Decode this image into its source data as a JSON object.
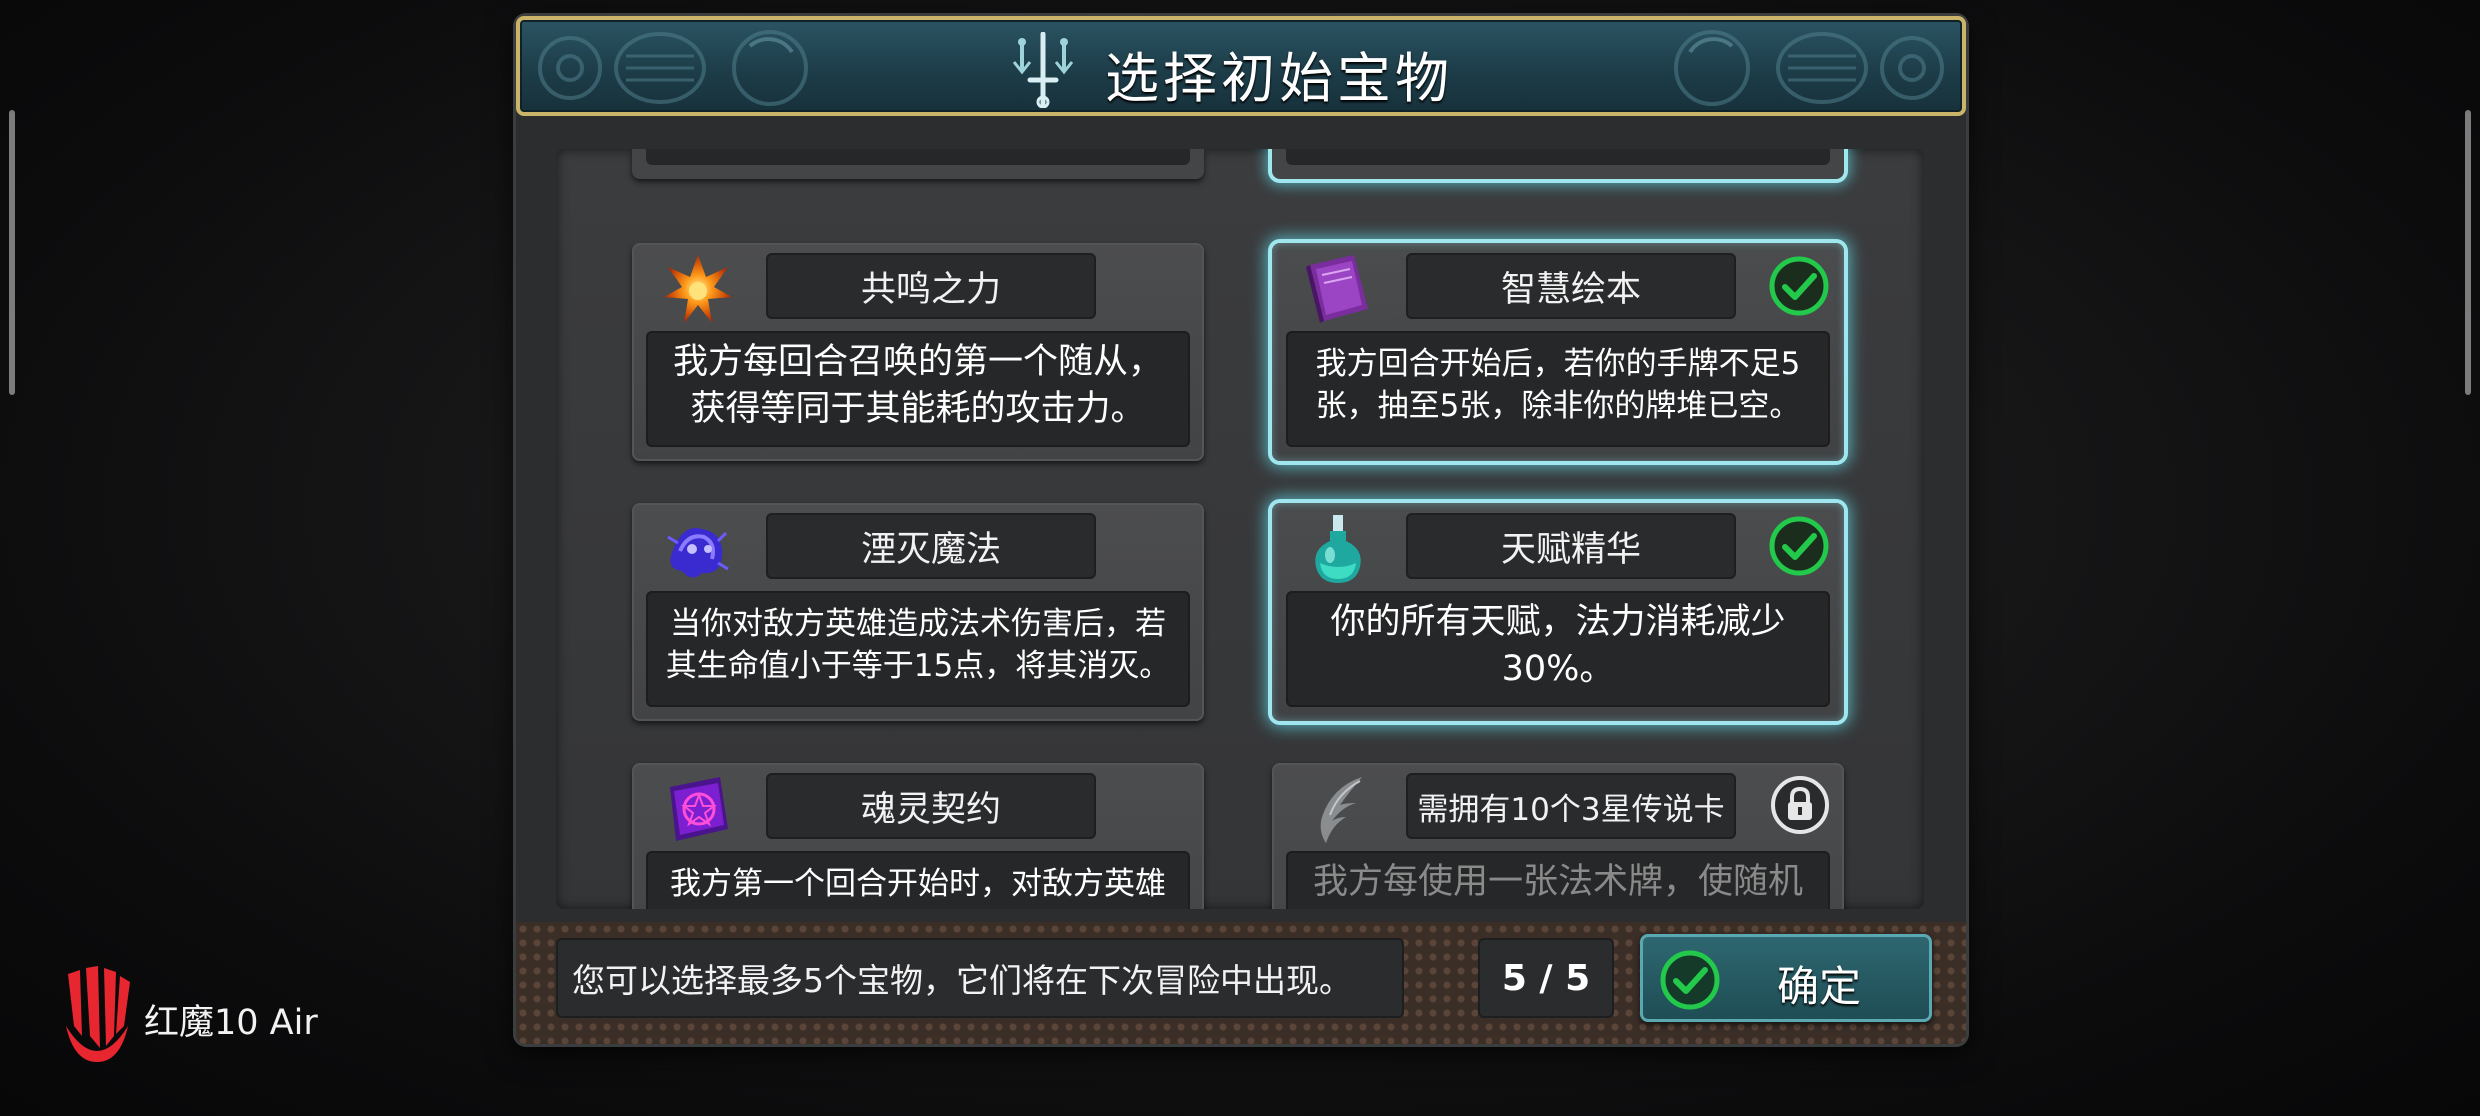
{
  "device_watermark": {
    "text": "红魔10 Air"
  },
  "dialog": {
    "title": "选择初始宝物",
    "title_icon": "sword-rune-icon"
  },
  "treasures": [
    {
      "name": "共鸣之力",
      "description": "我方每回合召唤的第一个随从，获得等同于其能耗的攻击力。",
      "icon": "orange-burst-icon",
      "selected": false,
      "locked": false
    },
    {
      "name": "智慧绘本",
      "description": "我方回合开始后，若你的手牌不足5张，抽至5张，除非你的牌堆已空。",
      "icon": "purple-book-icon",
      "selected": true,
      "locked": false
    },
    {
      "name": "湮灭魔法",
      "description": "当你对敌方英雄造成法术伤害后，若其生命值小于等于15点，将其消灭。",
      "icon": "blue-spirit-icon",
      "selected": false,
      "locked": false
    },
    {
      "name": "天赋精华",
      "description": "你的所有天赋，法力消耗减少30%。",
      "icon": "teal-potion-icon",
      "selected": true,
      "locked": false
    },
    {
      "name": "魂灵契约",
      "description": "我方第一个回合开始时，对敌方英雄造",
      "icon": "purple-scroll-icon",
      "selected": false,
      "locked": false
    },
    {
      "name": "需拥有10个3星传说卡",
      "description": "我方每使用一张法术牌，使随机",
      "icon": "silver-wing-icon",
      "selected": false,
      "locked": true
    }
  ],
  "footer": {
    "hint": "您可以选择最多5个宝物，它们将在下次冒险中出现。",
    "count": "5 / 5",
    "selected_count": 5,
    "max_count": 5,
    "confirm_label": "确定"
  },
  "colors": {
    "title_bar": "#1d3d49",
    "title_border": "#c9b469",
    "selected_glow": "#5fd7e4",
    "check_green": "#22c94a",
    "confirm_button": "#2e6770"
  }
}
